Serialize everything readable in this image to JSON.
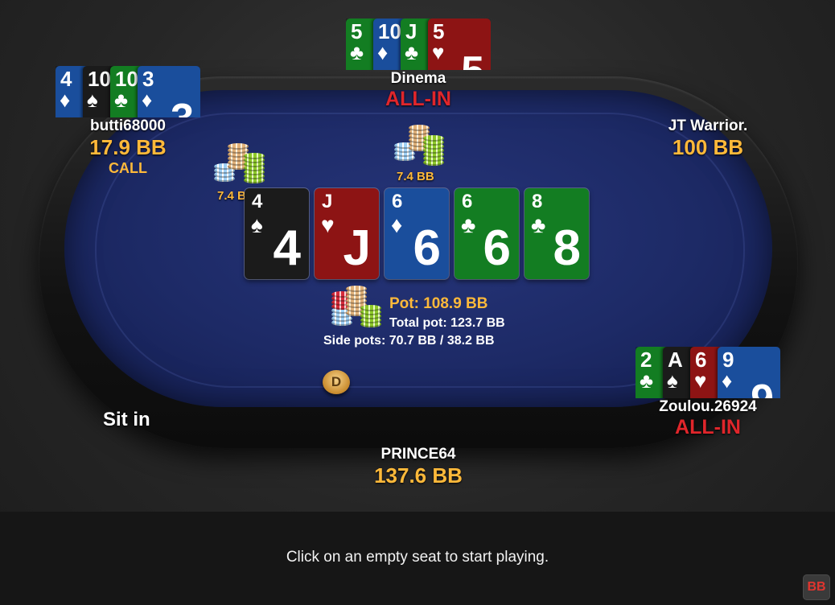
{
  "colors": {
    "spade": "#1b1b1b",
    "heart": "#8d1414",
    "diamond": "#1a4e9c",
    "club": "#137d22",
    "stack_text": "#ffb93a",
    "allin_text": "#e0262b"
  },
  "seats": {
    "dinema": {
      "name": "Dinema",
      "status": "ALL-IN",
      "cards": [
        {
          "rank": "5",
          "suit": "♣",
          "color": "club"
        },
        {
          "rank": "10",
          "suit": "♦",
          "color": "diamond"
        },
        {
          "rank": "J",
          "suit": "♣",
          "color": "club"
        },
        {
          "rank": "5",
          "suit": "♥",
          "color": "heart"
        }
      ]
    },
    "butti": {
      "name": "butti68000",
      "stack": "17.9 BB",
      "action": "CALL",
      "cards": [
        {
          "rank": "4",
          "suit": "♦",
          "color": "diamond"
        },
        {
          "rank": "10",
          "suit": "♠",
          "color": "spade"
        },
        {
          "rank": "10",
          "suit": "♣",
          "color": "club"
        },
        {
          "rank": "3",
          "suit": "♦",
          "color": "diamond"
        }
      ]
    },
    "jt": {
      "name": "JT Warrior.",
      "stack": "100 BB"
    },
    "zoulou": {
      "name": "Zoulou.26924",
      "status": "ALL-IN",
      "cards": [
        {
          "rank": "2",
          "suit": "♣",
          "color": "club"
        },
        {
          "rank": "A",
          "suit": "♠",
          "color": "spade"
        },
        {
          "rank": "6",
          "suit": "♥",
          "color": "heart"
        },
        {
          "rank": "9",
          "suit": "♦",
          "color": "diamond"
        }
      ]
    },
    "prince": {
      "name": "PRINCE64",
      "stack": "137.6 BB"
    },
    "sit_in": "Sit in"
  },
  "bets": {
    "butti": "7.4 BB",
    "dinema": "7.4 BB"
  },
  "board": [
    {
      "rank": "4",
      "suit": "♠",
      "color": "spade"
    },
    {
      "rank": "J",
      "suit": "♥",
      "color": "heart"
    },
    {
      "rank": "6",
      "suit": "♦",
      "color": "diamond"
    },
    {
      "rank": "6",
      "suit": "♣",
      "color": "club"
    },
    {
      "rank": "8",
      "suit": "♣",
      "color": "club"
    }
  ],
  "pot": {
    "main": "Pot: 108.9 BB",
    "total": "Total pot: 123.7 BB",
    "side": "Side pots: 70.7 BB / 38.2 BB"
  },
  "dealer_button": "D",
  "footer": {
    "message": "Click on an empty seat to start playing.",
    "bb_toggle": "BB"
  }
}
